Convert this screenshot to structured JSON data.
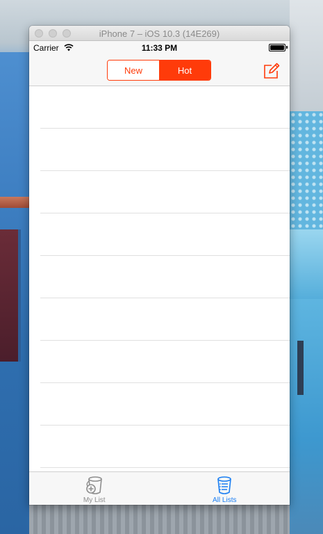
{
  "simulator": {
    "title": "iPhone 7 – iOS 10.3 (14E269)"
  },
  "status_bar": {
    "carrier": "Carrier",
    "time": "11:33 PM",
    "battery_level": 1.0
  },
  "nav": {
    "segments": [
      {
        "label": "New",
        "selected": false
      },
      {
        "label": "Hot",
        "selected": true
      }
    ],
    "compose_icon": "compose-icon"
  },
  "list": {
    "row_count": 9
  },
  "tab_bar": {
    "tabs": [
      {
        "label": "My List",
        "icon": "bucket-plus-icon",
        "selected": false
      },
      {
        "label": "All Lists",
        "icon": "bucket-list-icon",
        "selected": true
      }
    ]
  },
  "colors": {
    "accent": "#ff3b0a",
    "tab_selected": "#1a7ef2",
    "tab_unselected": "#8e8e8e"
  }
}
